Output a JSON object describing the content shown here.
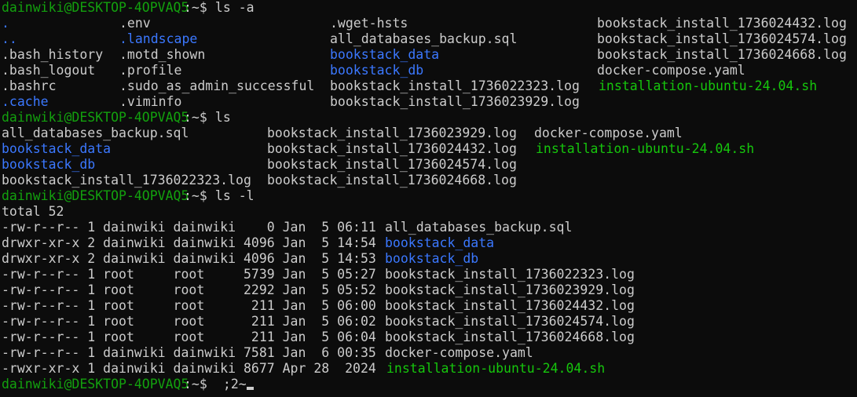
{
  "theme": {
    "background": "#0c0c0c",
    "foreground": "#cccccc",
    "prompt_color": "#13a10e",
    "directory_color": "#3b78ff",
    "executable_color": "#16c60c"
  },
  "prompt": {
    "user_host": "dainwiki@DESKTOP-4OPVAQ5",
    "path_suffix": ":~$",
    "path_suffix_last": ":~$"
  },
  "commands": {
    "ls_a": " ls -a",
    "ls": " ls",
    "ls_l": " ls -l",
    "current_input": " ;2~"
  },
  "ls_a_output": {
    "col1": [
      ".",
      "..",
      ".bash_history",
      ".bash_logout",
      ".bashrc",
      ".cache"
    ],
    "col2": [
      ".env",
      ".landscape",
      ".motd_shown",
      ".profile",
      ".sudo_as_admin_successful",
      ".viminfo"
    ],
    "col3": [
      ".wget-hsts",
      "all_databases_backup.sql",
      "bookstack_data",
      "bookstack_db",
      "bookstack_install_1736022323.log",
      "bookstack_install_1736023929.log"
    ],
    "col4": [
      "bookstack_install_1736024432.log",
      "bookstack_install_1736024574.log",
      "bookstack_install_1736024668.log",
      "docker-compose.yaml",
      "installation-ubuntu-24.04.sh"
    ]
  },
  "ls_output": {
    "col1": [
      "all_databases_backup.sql",
      "bookstack_data",
      "bookstack_db",
      "bookstack_install_1736022323.log"
    ],
    "col2": [
      "bookstack_install_1736023929.log",
      "bookstack_install_1736024432.log",
      "bookstack_install_1736024574.log",
      "bookstack_install_1736024668.log"
    ],
    "col3": [
      "docker-compose.yaml",
      "installation-ubuntu-24.04.sh"
    ]
  },
  "ls_l_output": {
    "total": "total 52",
    "rows": [
      {
        "meta": "-rw-r--r-- 1 dainwiki dainwiki    0 Jan  5 06:11 ",
        "name": "all_databases_backup.sql"
      },
      {
        "meta": "drwxr-xr-x 2 dainwiki dainwiki 4096 Jan  5 14:54 ",
        "name": "bookstack_data"
      },
      {
        "meta": "drwxr-xr-x 2 dainwiki dainwiki 4096 Jan  5 14:53 ",
        "name": "bookstack_db"
      },
      {
        "meta": "-rw-r--r-- 1 root     root     5739 Jan  5 05:27 ",
        "name": "bookstack_install_1736022323.log"
      },
      {
        "meta": "-rw-r--r-- 1 root     root     2292 Jan  5 05:52 ",
        "name": "bookstack_install_1736023929.log"
      },
      {
        "meta": "-rw-r--r-- 1 root     root      211 Jan  5 06:00 ",
        "name": "bookstack_install_1736024432.log"
      },
      {
        "meta": "-rw-r--r-- 1 root     root      211 Jan  5 06:02 ",
        "name": "bookstack_install_1736024574.log"
      },
      {
        "meta": "-rw-r--r-- 1 root     root      211 Jan  5 06:04 ",
        "name": "bookstack_install_1736024668.log"
      },
      {
        "meta": "-rw-r--r-- 1 dainwiki dainwiki 7581 Jan  6 00:35 ",
        "name": "docker-compose.yaml"
      },
      {
        "meta": "-rwxr-xr-x 1 dainwiki dainwiki 8677 Apr 28  2024 ",
        "name": "installation-ubuntu-24.04.sh"
      }
    ]
  }
}
